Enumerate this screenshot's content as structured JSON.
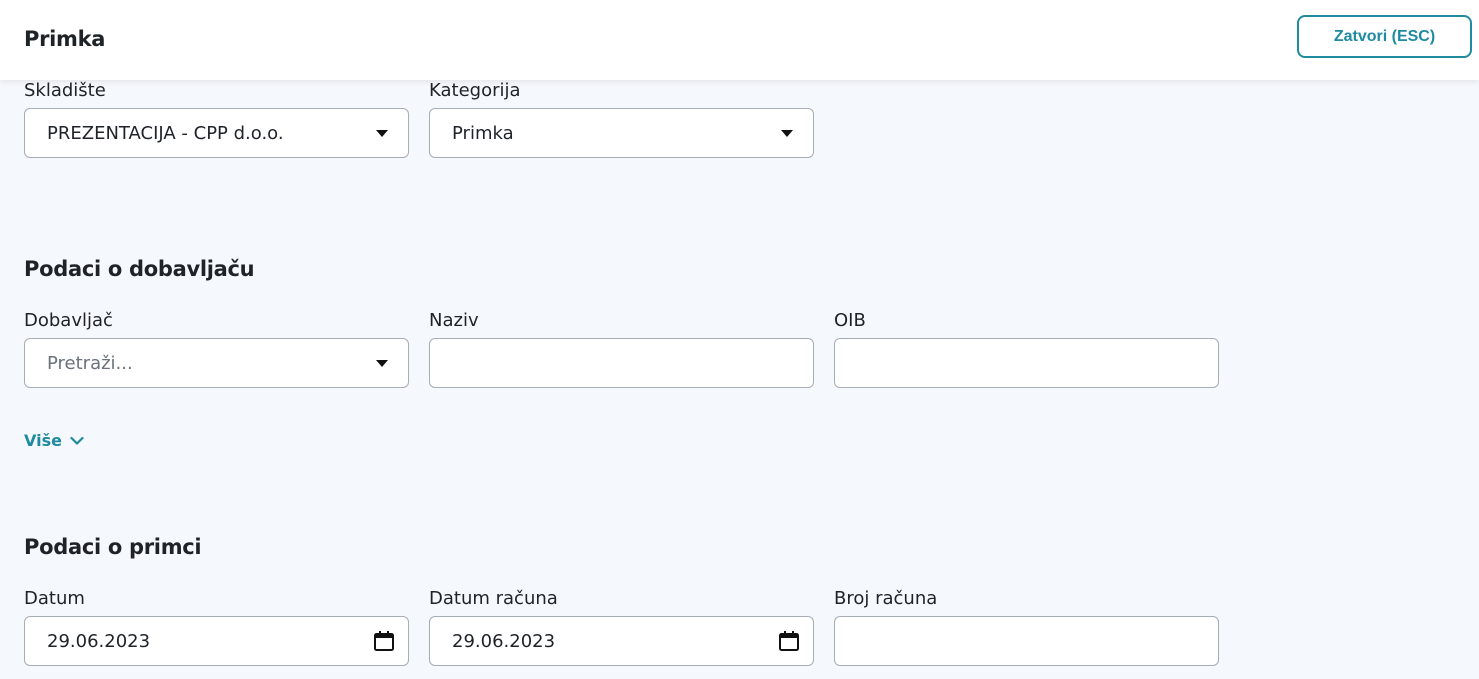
{
  "header": {
    "title": "Primka",
    "close_label": "Zatvori (ESC)"
  },
  "top_fields": {
    "warehouse": {
      "label": "Skladište",
      "value": "PREZENTACIJA - CPP d.o.o."
    },
    "category": {
      "label": "Kategorija",
      "value": "Primka"
    }
  },
  "supplier_section": {
    "title": "Podaci o dobavljaču",
    "supplier": {
      "label": "Dobavljač",
      "placeholder": "Pretraži..."
    },
    "name": {
      "label": "Naziv",
      "value": ""
    },
    "oib": {
      "label": "OIB",
      "value": ""
    },
    "more_label": "Više"
  },
  "receipt_section": {
    "title": "Podaci o primci",
    "date": {
      "label": "Datum",
      "value": "29.06.2023"
    },
    "invoice_date": {
      "label": "Datum računa",
      "value": "29.06.2023"
    },
    "invoice_number": {
      "label": "Broj računa",
      "value": ""
    }
  },
  "colors": {
    "accent": "#1f8aa0",
    "background": "#f5f8fc",
    "field_border": "#a7adb5"
  },
  "icons": {
    "dropdown": "caret-down-icon",
    "calendar": "calendar-icon",
    "expand": "chevron-down-icon"
  }
}
